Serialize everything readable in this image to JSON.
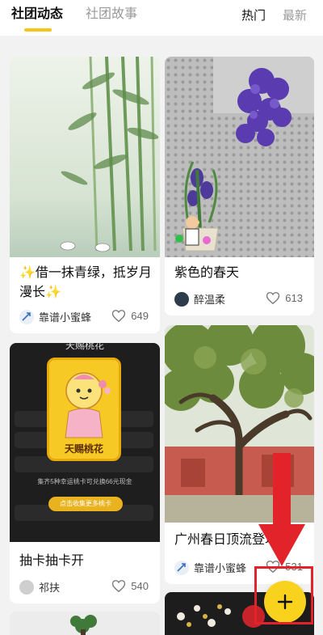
{
  "header": {
    "tabs": [
      {
        "label": "社团动态",
        "active": true
      },
      {
        "label": "社团故事",
        "active": false
      }
    ],
    "sort": [
      {
        "label": "热门",
        "active": true
      },
      {
        "label": "最新",
        "active": false
      }
    ]
  },
  "feed": {
    "cards": [
      {
        "title": "✨借一抹青绿，抵岁月漫长✨",
        "author": "靠谱小蜜蜂",
        "likes": "649"
      },
      {
        "title": "紫色的春天",
        "author": "醉温柔",
        "likes": "613"
      },
      {
        "title": "抽卡抽卡开",
        "author": "祁扶",
        "likes": "540",
        "image_text": {
          "top": "天赐桃花",
          "card_label": "天赐桃花",
          "line1": "集齐5种幸运桃卡可兑换66元现金",
          "button": "点击收集更多桃卡"
        }
      },
      {
        "title": "广州春日顶流登场",
        "author": "靠谱小蜜蜂",
        "likes": "531"
      }
    ]
  },
  "fab": {
    "icon": "plus-icon"
  },
  "annotation": {
    "color": "#e2232a"
  },
  "colors": {
    "accent": "#f5c518",
    "fab": "#f8d21c"
  }
}
